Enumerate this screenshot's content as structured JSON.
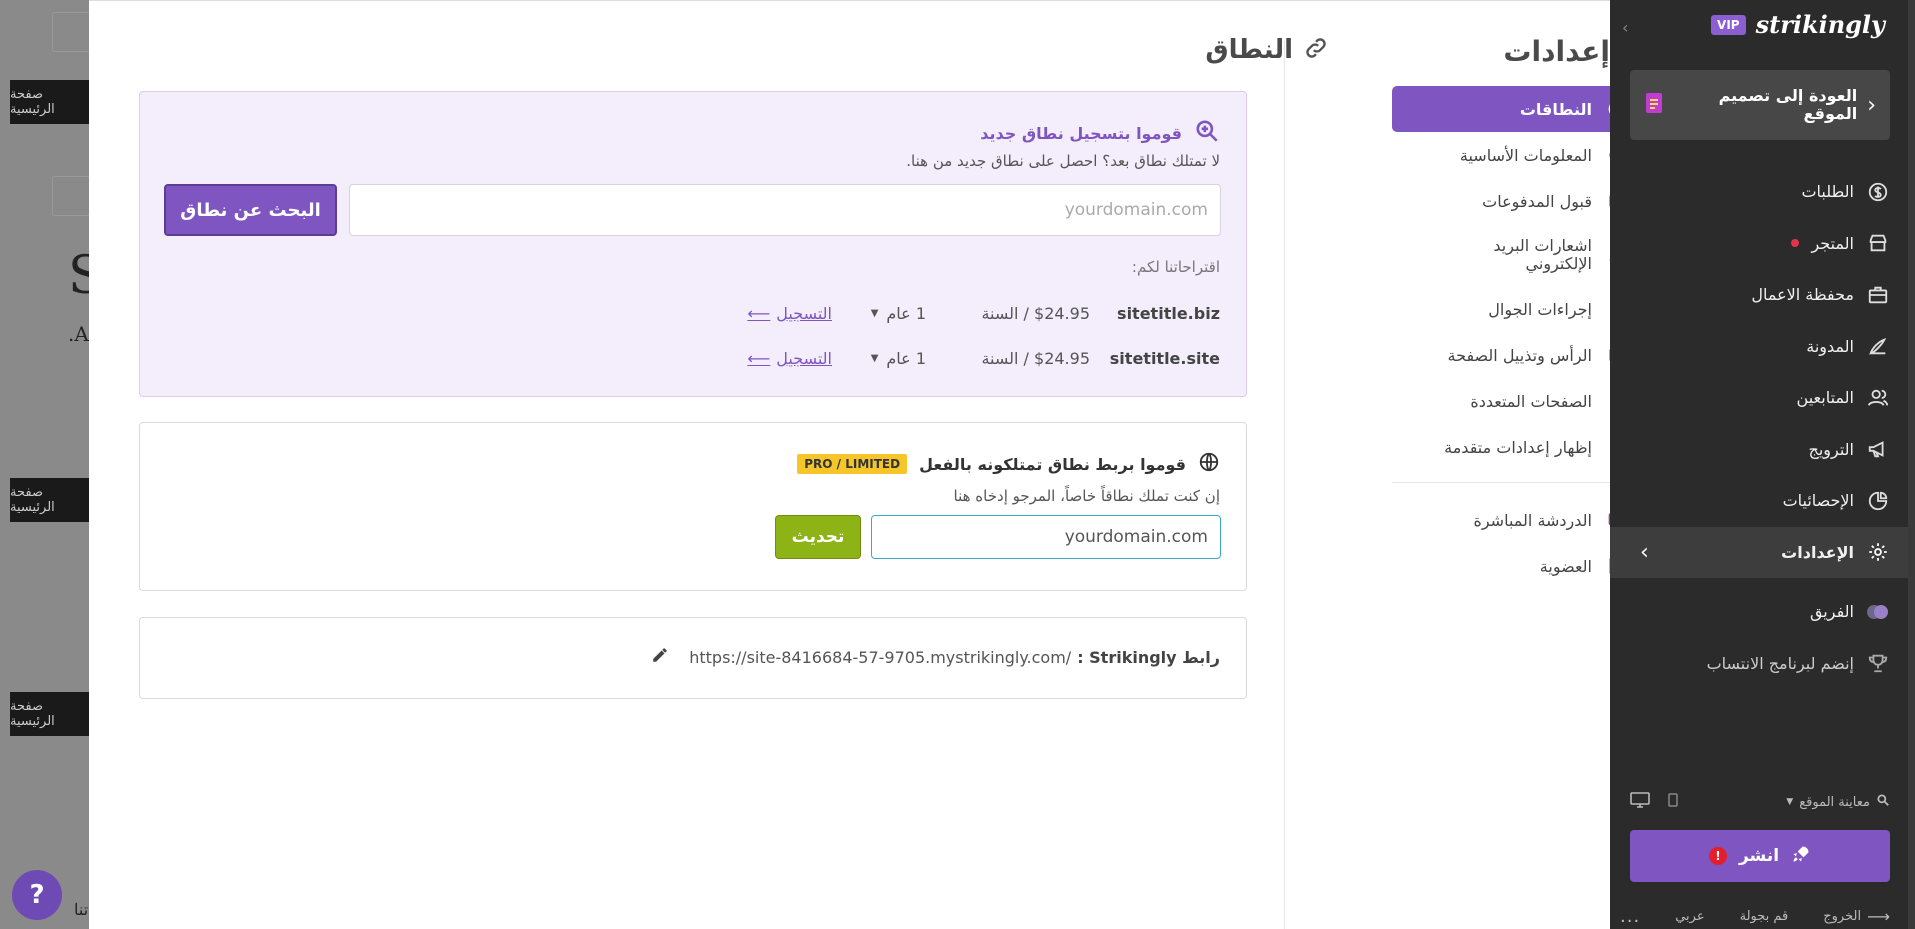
{
  "background": {
    "strip_label": "صفحة الرئيسية",
    "letter_s": "S",
    "letter_a": ".A",
    "letter_bottom": "تنا."
  },
  "settings": {
    "title": "إعدادات",
    "nav": [
      {
        "label": "النطاقات",
        "icon": "globe-icon"
      },
      {
        "label": "المعلومات الأساسية",
        "icon": "info-icon"
      },
      {
        "label": "قبول المدفوعات",
        "icon": "card-icon"
      },
      {
        "label": "اشعارات البريد الإلكتروني",
        "icon": "bell-icon"
      },
      {
        "label": "إجراءات الجوال",
        "icon": "mobile-icon"
      },
      {
        "label": "الرأس وتذييل الصفحة",
        "icon": "layout-icon"
      },
      {
        "label": "الصفحات المتعددة",
        "icon": "pages-icon"
      },
      {
        "label": "إظهار إعدادات متقدمة",
        "icon": "chevron-down-icon"
      }
    ],
    "extra": [
      {
        "label": "الدردشة المباشرة",
        "icon": "chat-icon"
      },
      {
        "label": "العضوية",
        "icon": "member-icon"
      }
    ]
  },
  "domain": {
    "title": "النطاق",
    "register": {
      "title": "قوموا بتسجيل نطاق جديد",
      "subtitle": "لا تمتلك نطاق بعد؟ احصل على نطاق جديد من هنا.",
      "placeholder": "yourdomain.com",
      "search_button": "البحث عن نطاق",
      "suggestions_label": "اقتراحاتنا لكم:",
      "suggestions": [
        {
          "domain": "sitetitle.biz",
          "price": "$24.95 / السنة",
          "term": "1 عام",
          "action": "التسجيل"
        },
        {
          "domain": "sitetitle.site",
          "price": "$24.95 / السنة",
          "term": "1 عام",
          "action": "التسجيل"
        }
      ]
    },
    "connect": {
      "title": "قوموا بربط نطاق تمتلكونه بالفعل",
      "badge": "PRO / LIMITED",
      "subtitle": "إن كنت تملك نطاقاً خاصاً، المرجو إدخاه هنا",
      "value": "yourdomain.com",
      "update_button": "تحديث"
    },
    "url": {
      "label": "رابط Strikingly :",
      "value": "https://site-8416684-57-9705.mystrikingly.com/"
    }
  },
  "sidebar": {
    "vip": "VIP",
    "logo": "strikingly",
    "back_label": "العودة إلى تصميم الموقع",
    "items": [
      {
        "label": "الطلبات",
        "icon": "dollar-icon"
      },
      {
        "label": "المتجر",
        "icon": "store-icon",
        "dot": true
      },
      {
        "label": "محفظة الاعمال",
        "icon": "portfolio-icon"
      },
      {
        "label": "المدونة",
        "icon": "blog-icon"
      },
      {
        "label": "المتابعين",
        "icon": "followers-icon"
      },
      {
        "label": "الترويج",
        "icon": "megaphone-icon"
      },
      {
        "label": "الإحصائيات",
        "icon": "pie-icon"
      },
      {
        "label": "الإعدادات",
        "icon": "gear-icon",
        "active": true
      },
      {
        "label": "الفريق",
        "icon": "team-icon"
      },
      {
        "label": "إنضم لبرنامج الانتساب",
        "icon": "trophy-icon"
      }
    ],
    "preview": "معاينة الموقع",
    "publish": "انشر",
    "footer": {
      "logout": "الخروج",
      "tour": "قم بجولة",
      "language": "عربي",
      "more": "..."
    }
  },
  "help": "?",
  "colors": {
    "accent": "#7f56c1",
    "green": "#8db317",
    "badge": "#f5c52a",
    "sidebar": "#2b2b2b"
  }
}
